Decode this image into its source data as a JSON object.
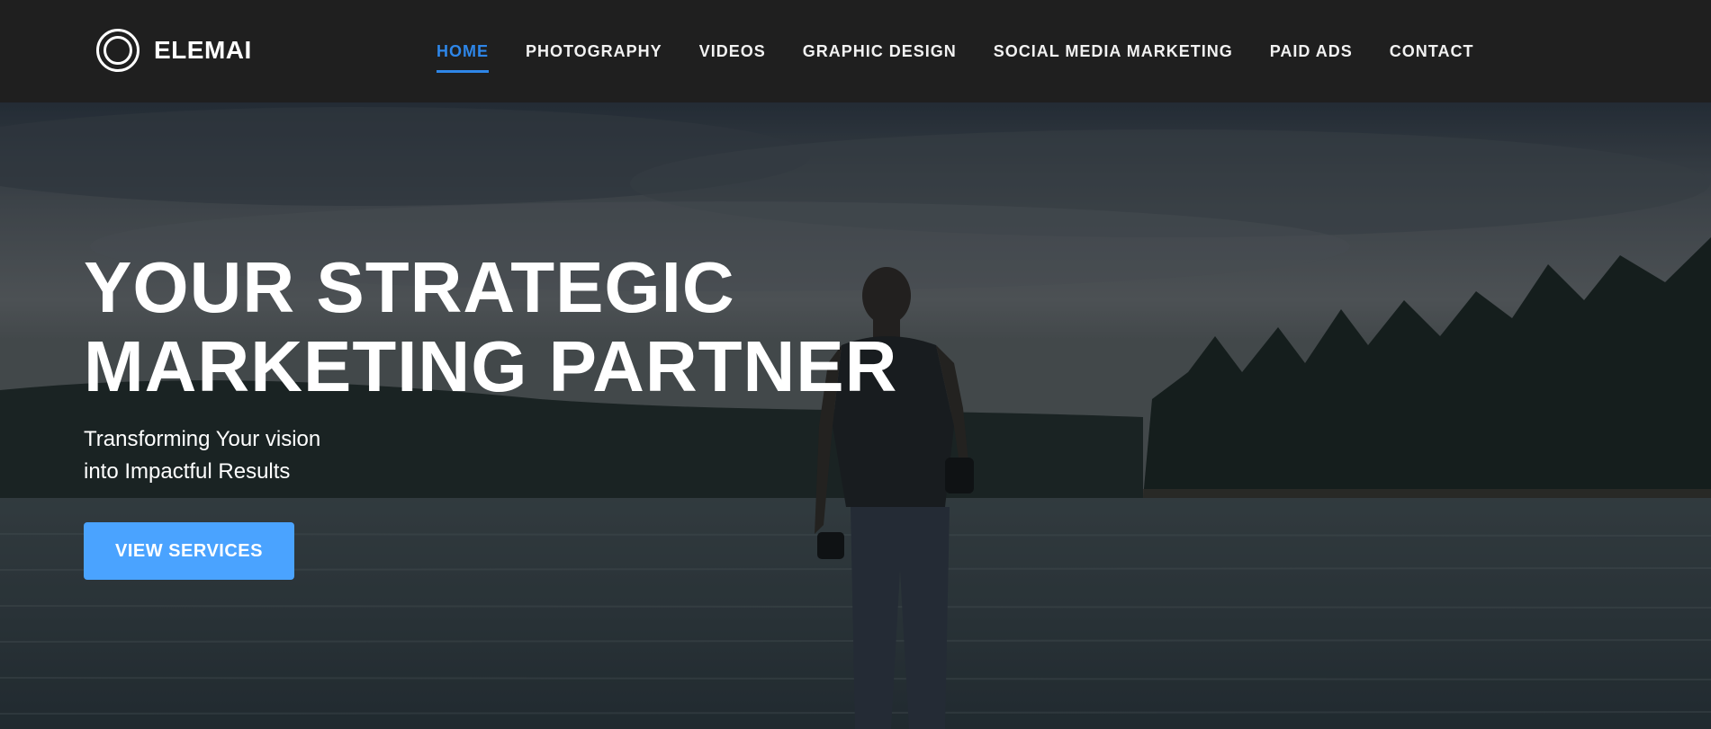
{
  "brand": {
    "name": "ELEMAI",
    "logo_icon": "double-ring-logo-icon"
  },
  "nav": {
    "items": [
      {
        "label": "HOME",
        "active": true
      },
      {
        "label": "PHOTOGRAPHY",
        "active": false
      },
      {
        "label": "VIDEOS",
        "active": false
      },
      {
        "label": "GRAPHIC DESIGN",
        "active": false
      },
      {
        "label": "SOCIAL MEDIA MARKETING",
        "active": false
      },
      {
        "label": "PAID ADS",
        "active": false
      },
      {
        "label": "CONTACT",
        "active": false
      }
    ]
  },
  "hero": {
    "title_lines": [
      "YOUR STRATEGIC",
      "MARKETING PARTNER"
    ],
    "subtitle_lines": [
      "Transforming Your vision",
      "into Impactful Results"
    ],
    "cta_label": "VIEW SERVICES"
  },
  "colors": {
    "header_bg": "#1f1f1f",
    "accent": "#2e86e8",
    "cta_bg": "#4aa3ff",
    "text": "#ffffff"
  }
}
